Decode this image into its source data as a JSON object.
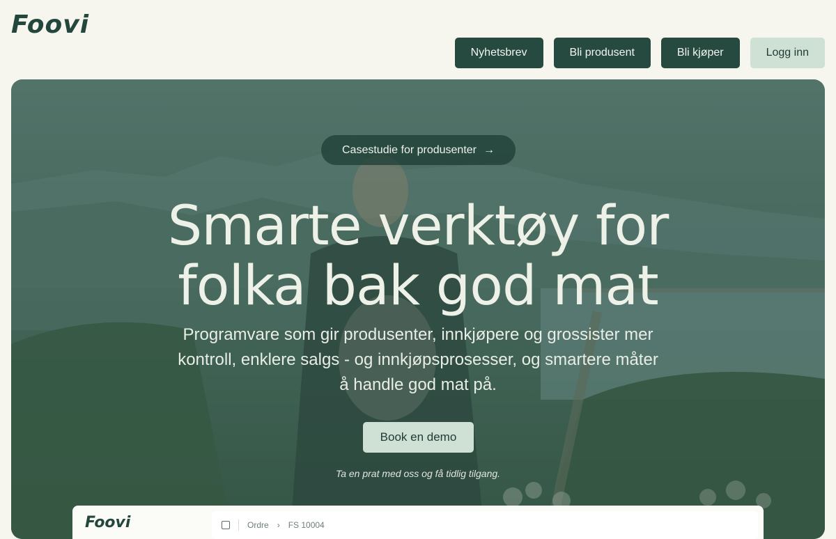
{
  "brand": {
    "logo": "Foovi"
  },
  "nav": {
    "newsletter": "Nyhetsbrev",
    "become_producer": "Bli produsent",
    "become_buyer": "Bli kjøper",
    "login": "Logg inn"
  },
  "hero": {
    "pill_label": "Casestudie for produsenter",
    "pill_icon": "arrow-right-icon",
    "headline_line1": "Smarte verktøy for",
    "headline_line2": "folka bak god mat",
    "subtitle": "Programvare som gir produsenter, innkjøpere og grossister mer kontroll, enklere salgs - og innkjøpsprosesser, og smartere måter å handle god mat på.",
    "cta_label": "Book en demo",
    "note": "Ta en prat med oss og få tidlig tilgang."
  },
  "app_preview": {
    "logo": "Foovi",
    "breadcrumb_root": "Ordre",
    "breadcrumb_current": "FS 10004"
  },
  "colors": {
    "background": "#f6f6ef",
    "primary": "#264a40",
    "accent_light": "#cfe0d4",
    "text_light": "#eef1e8"
  }
}
